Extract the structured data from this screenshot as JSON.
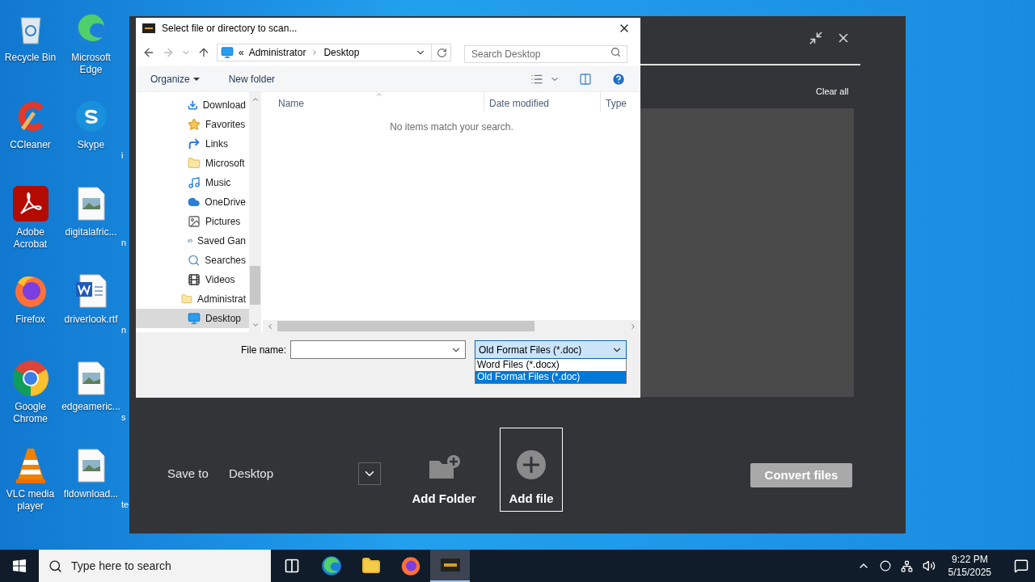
{
  "desktop": {
    "icons": [
      {
        "label": "Recycle Bin",
        "kind": "recycle"
      },
      {
        "label": "Microsoft Edge",
        "kind": "edge"
      },
      {
        "kind": "none"
      },
      {
        "label": "CCleaner",
        "kind": "ccleaner"
      },
      {
        "label": "Skype",
        "kind": "skype"
      },
      {
        "label": "i",
        "kind": "partial"
      },
      {
        "label": "Adobe Acrobat",
        "kind": "acrobat"
      },
      {
        "label": "digitalafric...",
        "kind": "image"
      },
      {
        "label": "n",
        "kind": "partial"
      },
      {
        "label": "Firefox",
        "kind": "firefox"
      },
      {
        "label": "driverlook.rtf",
        "kind": "word"
      },
      {
        "label": "n",
        "kind": "partial"
      },
      {
        "label": "Google Chrome",
        "kind": "chrome"
      },
      {
        "label": "edgeameric...",
        "kind": "image"
      },
      {
        "label": "s",
        "kind": "partial"
      },
      {
        "label": "VLC media player",
        "kind": "vlc"
      },
      {
        "label": "fldownload...",
        "kind": "image"
      },
      {
        "label": "te",
        "kind": "partial"
      }
    ]
  },
  "app": {
    "clear_all": "Clear all",
    "save_to": {
      "label": "Save to",
      "value": "Desktop"
    },
    "buttons": [
      {
        "label": "Add Folder",
        "kind": "folder",
        "focused": false
      },
      {
        "label": "Add file",
        "kind": "file",
        "focused": true
      }
    ],
    "convert": {
      "label": "Convert files",
      "disabled": true
    }
  },
  "dialog": {
    "title": "Select file or directory to scan...",
    "breadcrumb": [
      "«",
      "Administrator",
      "Desktop"
    ],
    "search": {
      "placeholder": "Search Desktop"
    },
    "toolbar": [
      "Organize",
      "New folder"
    ],
    "nav": [
      {
        "label": "Download",
        "kind": "download",
        "selected": false
      },
      {
        "label": "Favorites",
        "kind": "star",
        "selected": false
      },
      {
        "label": "Links",
        "kind": "link",
        "selected": false
      },
      {
        "label": "Microsoft",
        "kind": "folder",
        "selected": false
      },
      {
        "label": "Music",
        "kind": "music",
        "selected": false
      },
      {
        "label": "OneDrive",
        "kind": "cloud",
        "selected": false
      },
      {
        "label": "Pictures",
        "kind": "pictures",
        "selected": false
      },
      {
        "label": "Saved Gan",
        "kind": "games",
        "selected": false
      },
      {
        "label": "Searches",
        "kind": "search",
        "selected": false
      },
      {
        "label": "Videos",
        "kind": "video",
        "selected": false
      },
      {
        "label": "Administrat",
        "kind": "folder",
        "selected": false,
        "children": [
          {
            "label": "Desktop",
            "kind": "desktop",
            "selected": true
          }
        ]
      }
    ],
    "columns": [
      "Name",
      "Date modified",
      "Type"
    ],
    "empty": "No items match your search.",
    "file_name": {
      "label": "File name:"
    },
    "filter": {
      "value": "Old Format Files (*.doc)",
      "expanded": true,
      "options": [
        {
          "label": "Word Files (*.docx)",
          "selected": false
        },
        {
          "label": "Old Format Files (*.doc)",
          "selected": true
        }
      ]
    }
  },
  "taskbar": {
    "search": {
      "placeholder": "Type here to search"
    },
    "apps": [
      {
        "kind": "taskview",
        "active": false
      },
      {
        "kind": "edge",
        "active": false
      },
      {
        "kind": "explorer",
        "active": false
      },
      {
        "kind": "firefox",
        "active": false
      },
      {
        "kind": "app",
        "active": true
      }
    ],
    "time": "9:22 PM",
    "date": "5/15/2025"
  }
}
